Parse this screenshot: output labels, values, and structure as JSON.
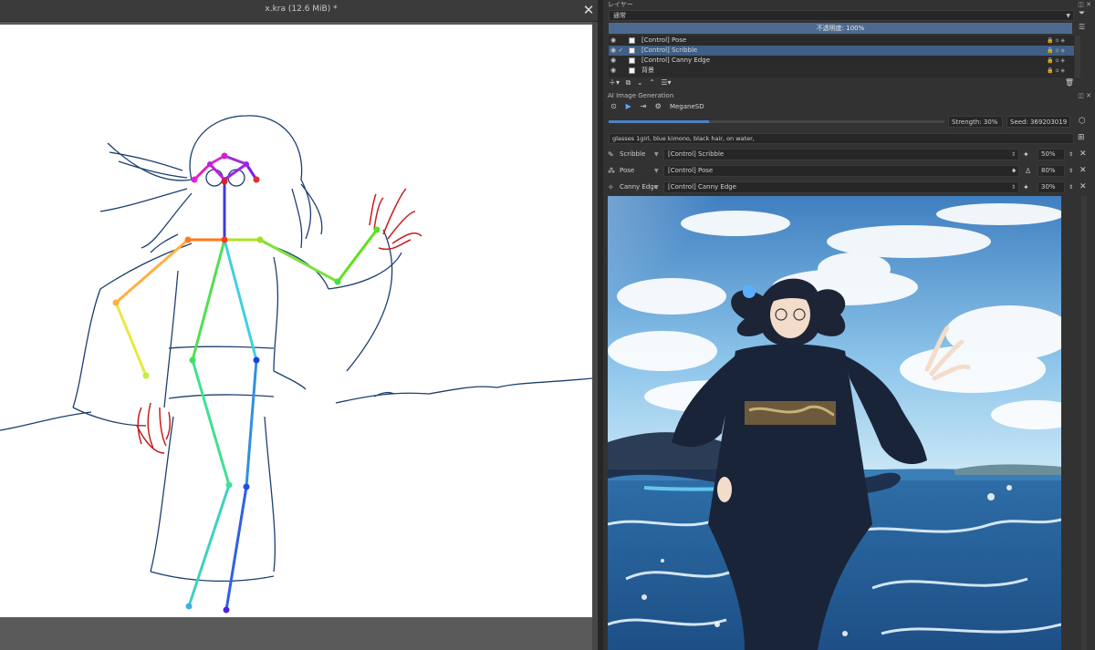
{
  "canvas": {
    "title": "x.kra (12.6 MiB) *",
    "close_glyph": "✕"
  },
  "layers_panel": {
    "title": "レイヤー",
    "blend_mode": "通常",
    "opacity_label": "不透明度: 100%",
    "layers": [
      {
        "name": "[Control] Pose",
        "selected": false
      },
      {
        "name": "[Control] Scribble",
        "selected": true
      },
      {
        "name": "[Control] Canny Edge",
        "selected": false
      },
      {
        "name": "背景",
        "selected": false
      }
    ]
  },
  "ai_panel": {
    "title": "AI Image Generation",
    "model": "MeganeSD",
    "progress": 0.3,
    "strength": "Strength: 30%",
    "seed": "Seed: 369203019",
    "prompt": "glasses 1girl, blue kimono, black hair, on water,",
    "controls": [
      {
        "icon": "scribble-icon",
        "label": "Scribble",
        "layer": "[Control] Scribble",
        "strength": "50%"
      },
      {
        "icon": "pose-icon",
        "label": "Pose",
        "layer": "[Control] Pose",
        "strength": "80%"
      },
      {
        "icon": "canny-edge-icon",
        "label": "Canny Edge",
        "layer": "[Control] Canny Edge",
        "strength": "30%"
      }
    ]
  },
  "colors": {
    "accent": "#4e6b8f",
    "selected_row": "#3e5f86",
    "play": "#5aa6ff"
  }
}
